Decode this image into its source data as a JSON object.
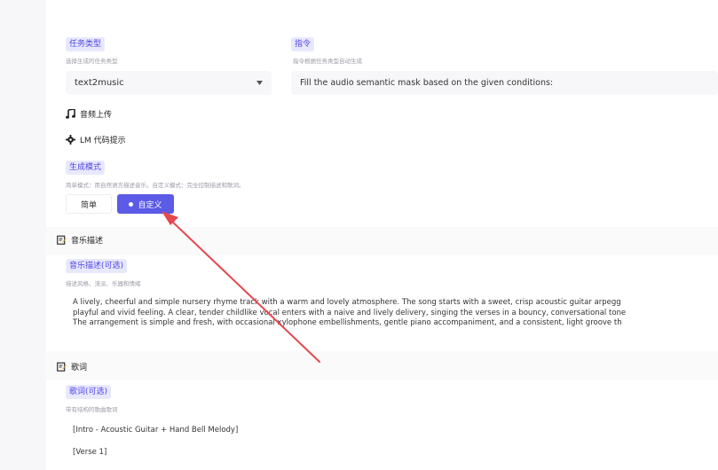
{
  "task_type": {
    "label": "任务类型",
    "hint": "选择生成的任务类型",
    "selected": "text2music"
  },
  "instruction": {
    "label": "指令",
    "hint": "指令根据任务类型自动生成",
    "value": "Fill the audio semantic mask based on the given conditions:"
  },
  "audio_upload": {
    "title": "音频上传",
    "icon": "music-note-icon"
  },
  "lm_hint": {
    "title": "LM 代码提示",
    "icon": "gear-icon"
  },
  "gen_mode": {
    "label": "生成模式",
    "hint": "简单模式：用自然语言描述音乐。自定义模式：完全控制描述和歌词。",
    "options": [
      "简单",
      "自定义"
    ],
    "selected": "自定义"
  },
  "music_desc": {
    "title": "音乐描述",
    "label": "音乐描述(可选)",
    "hint": "描述风格、流派、乐器和情绪",
    "lines": [
      "A lively, cheerful and simple nursery rhyme track with a warm and lovely atmosphere. The song starts with a sweet, crisp acoustic guitar arpegg",
      "playful and vivid feeling. A clear, tender childlike vocal enters with a naive and lively delivery, singing the verses in a bouncy, conversational tone",
      "The arrangement is simple and fresh, with occasional xylophone embellishments, gentle piano accompaniment, and a consistent, light groove th"
    ]
  },
  "lyrics": {
    "title": "歌词",
    "label": "歌词(可选)",
    "hint": "带有结构的歌曲歌词",
    "lines": [
      "[Intro - Acoustic Guitar + Hand Bell Melody]",
      "[Verse 1]"
    ]
  },
  "colors": {
    "accent": "#5b5be8",
    "tag_bg": "#e8e8fd",
    "tag_text": "#4f46e5",
    "arrow": "#e5484d"
  }
}
